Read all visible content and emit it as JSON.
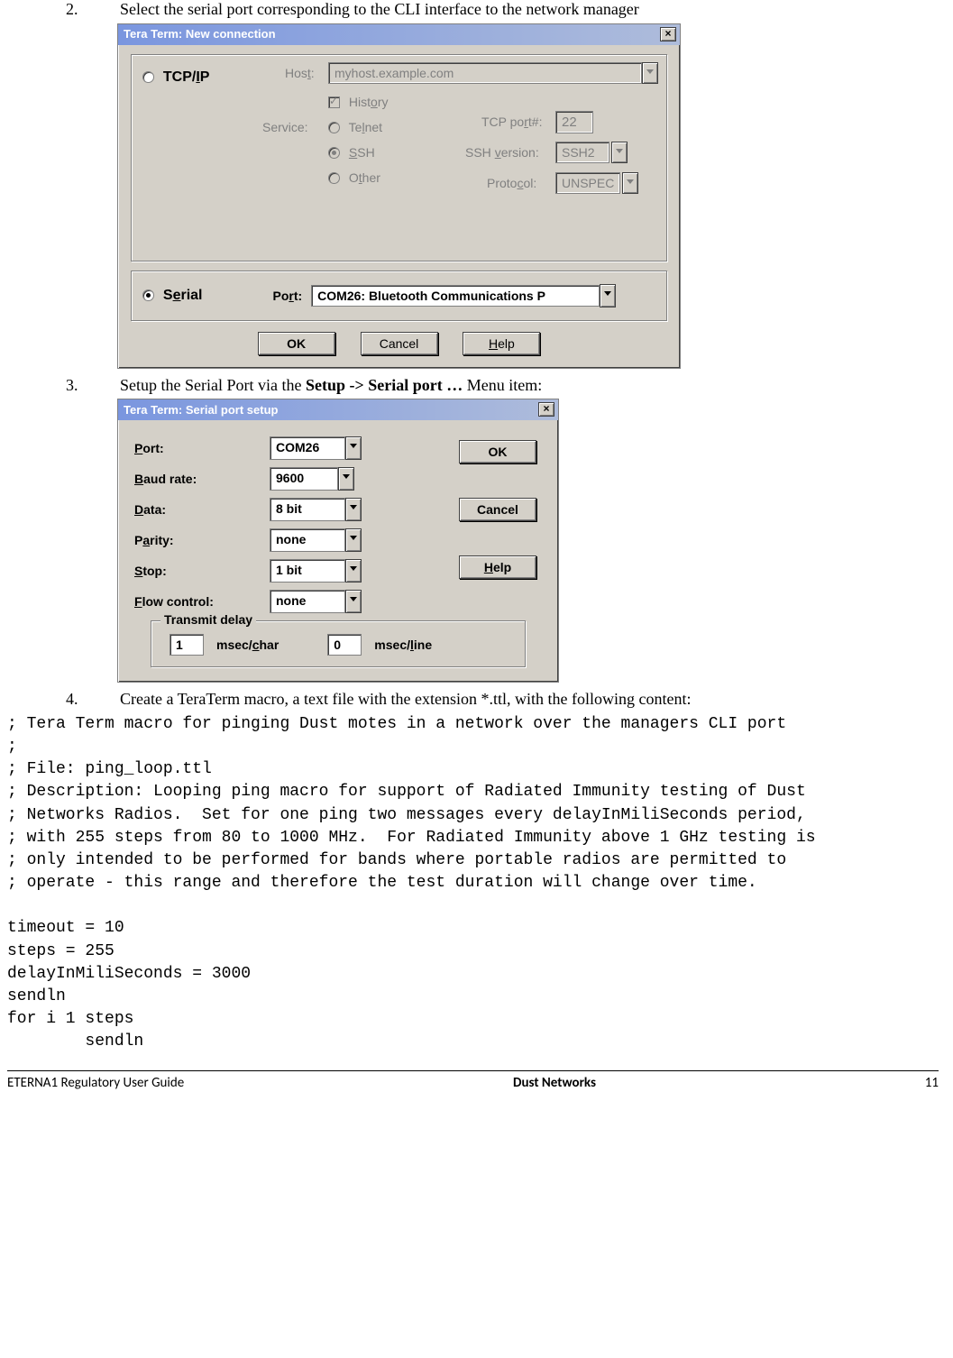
{
  "step2": {
    "num": "2.",
    "text": "Select the serial port corresponding to the CLI interface to the network manager"
  },
  "dialog1": {
    "title": "Tera Term: New connection",
    "tcpip_label": "TCP/IP",
    "host_label": "Host:",
    "host_value": "myhost.example.com",
    "history_label": "History",
    "service_label": "Service:",
    "telnet_label": "Telnet",
    "ssh_label": "SSH",
    "other_label": "Other",
    "tcpport_label": "TCP port#:",
    "tcpport_value": "22",
    "sshver_label": "SSH version:",
    "sshver_value": "SSH2",
    "protocol_label": "Protocol:",
    "protocol_value": "UNSPEC",
    "serial_label": "Serial",
    "port_label": "Port:",
    "port_value": "COM26: Bluetooth Communications P",
    "ok": "OK",
    "cancel": "Cancel",
    "help": "Help",
    "help_u": "H"
  },
  "step3": {
    "num": "3.",
    "prefix": "Setup the Serial Port via the ",
    "bold": "Setup -> Serial port …",
    "suffix": " Menu item:"
  },
  "dialog2": {
    "title": "Tera Term: Serial port setup",
    "port_label": "Port:",
    "port_value": "COM26",
    "baud_label": "Baud rate:",
    "baud_value": "9600",
    "data_label": "Data:",
    "data_value": "8 bit",
    "parity_label": "Parity:",
    "parity_value": "none",
    "stop_label": "Stop:",
    "stop_value": "1 bit",
    "flow_label": "Flow control:",
    "flow_value": "none",
    "ok": "OK",
    "cancel": "Cancel",
    "help": "Help",
    "help_u": "H",
    "td_title": "Transmit delay",
    "td_char_val": "1",
    "td_char_lbl": "msec/char",
    "td_line_val": "0",
    "td_line_lbl": "msec/line"
  },
  "step4": {
    "num": "4.",
    "text": "Create a TeraTerm macro, a text file with the extension *.ttl, with the following content:"
  },
  "code": "; Tera Term macro for pinging Dust motes in a network over the managers CLI port\n;\n; File: ping_loop.ttl\n; Description: Looping ping macro for support of Radiated Immunity testing of Dust\n; Networks Radios.  Set for one ping two messages every delayInMiliSeconds period,\n; with 255 steps from 80 to 1000 MHz.  For Radiated Immunity above 1 GHz testing is\n; only intended to be performed for bands where portable radios are permitted to\n; operate - this range and therefore the test duration will change over time.\n\ntimeout = 10\nsteps = 255\ndelayInMiliSeconds = 3000\nsendln\nfor i 1 steps\n        sendln",
  "footer": {
    "left": "ETERNA1 Regulatory User Guide",
    "center": "Dust Networks",
    "right": "11"
  }
}
